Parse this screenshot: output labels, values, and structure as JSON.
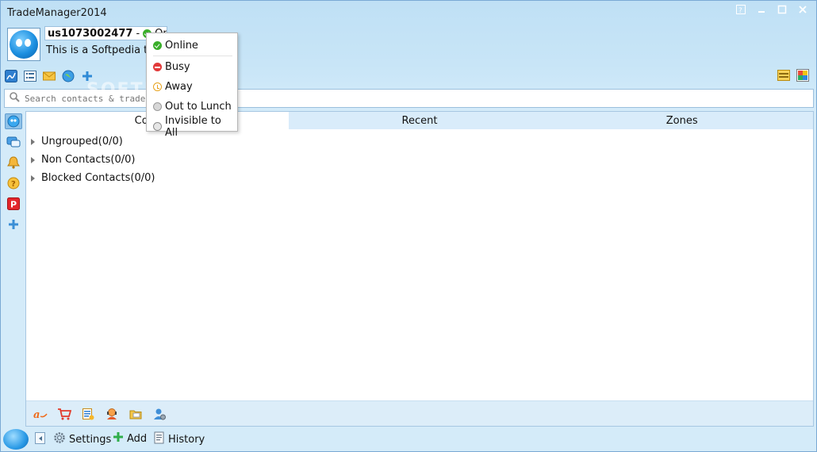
{
  "app": {
    "title": "TradeManager2014"
  },
  "colors": {
    "accent": "#bfe0f5",
    "online": "#3aae2a",
    "busy": "#e23a3a",
    "away": "#e7a21d"
  },
  "profile": {
    "username": "us1073002477",
    "separator": "-",
    "status_label": "Online",
    "signature": "This is a Softpedia tes"
  },
  "toolbar": {
    "icons": [
      "edit-icon",
      "list-icon",
      "mail-icon",
      "globe-icon",
      "plus-icon"
    ],
    "right_icons": [
      "calendar-icon",
      "skin-icon"
    ]
  },
  "search": {
    "placeholder": "Search contacts & trade"
  },
  "sidebar": {
    "icons": [
      "contacts-icon",
      "messages-icon",
      "bell-icon",
      "help-icon",
      "p-icon",
      "add-icon"
    ]
  },
  "tabs": [
    {
      "label": "Contacts"
    },
    {
      "label": "Recent"
    },
    {
      "label": "Zones"
    }
  ],
  "groups": [
    {
      "label": "Ungrouped(0/0)"
    },
    {
      "label": "Non Contacts(0/0)"
    },
    {
      "label": "Blocked Contacts(0/0)"
    }
  ],
  "bottom_tools": [
    "alibaba-icon",
    "cart-icon",
    "orders-icon",
    "service-icon",
    "folder-icon",
    "account-icon"
  ],
  "status_bar": {
    "settings": "Settings",
    "add": "Add",
    "history": "History"
  },
  "status_menu": {
    "items": [
      {
        "label": "Online",
        "status": "online"
      },
      {
        "label": "Busy",
        "status": "busy"
      },
      {
        "label": "Away",
        "status": "away"
      },
      {
        "label": "Out to Lunch",
        "status": "lunch"
      },
      {
        "label": "Invisible to All",
        "status": "invisible"
      }
    ]
  },
  "watermark": "SOFTPEDIA"
}
